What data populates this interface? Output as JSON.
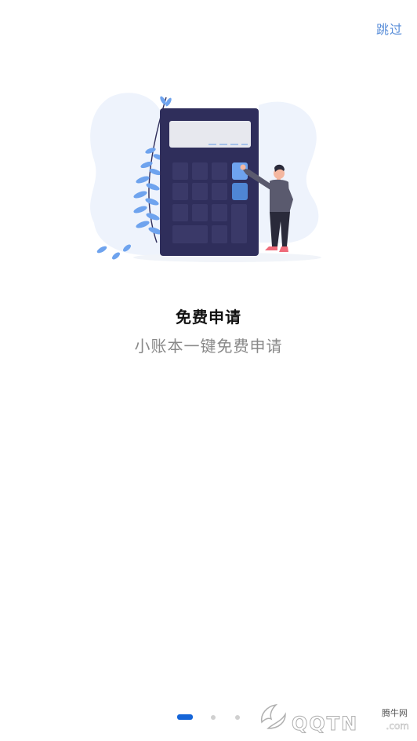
{
  "header": {
    "skip_label": "跳过"
  },
  "illustration": {
    "icon": "calculator-person-illustration"
  },
  "content": {
    "title": "免费申请",
    "subtitle": "小账本一键免费申请"
  },
  "pager": {
    "total": 3,
    "active_index": 0
  },
  "watermark": {
    "brand_cn": "腾牛网",
    "brand_latin": "QQTN",
    "domain": ".com"
  },
  "colors": {
    "accent": "#1565d8",
    "skip": "#5b8fd9",
    "calculator_body": "#2f2e5b",
    "blob": "#eef3fc",
    "leaf": "#6ea3ee"
  }
}
